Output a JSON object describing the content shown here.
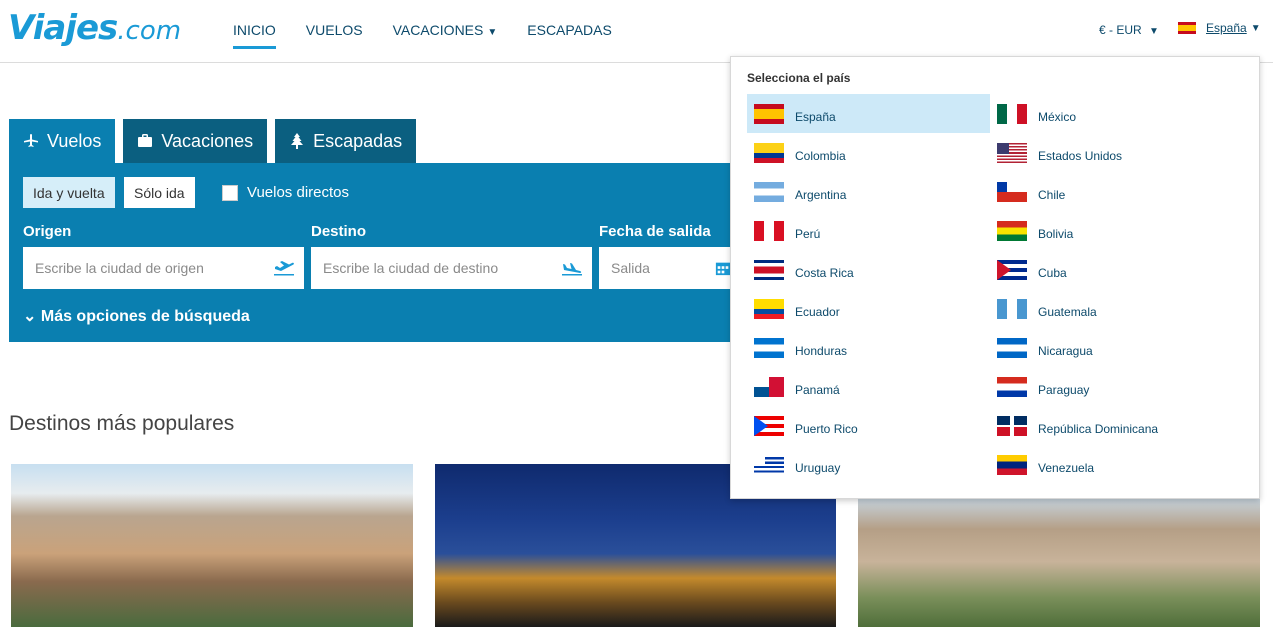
{
  "logo": {
    "text": "Viajes",
    "domain": ".com",
    "color": "#1a9ad6"
  },
  "nav": [
    {
      "label": "INICIO",
      "active": true
    },
    {
      "label": "VUELOS"
    },
    {
      "label": "VACACIONES",
      "caret": "▼"
    },
    {
      "label": "ESCAPADAS"
    }
  ],
  "header": {
    "currency": "€ - EUR",
    "caret": "▼",
    "country": "España",
    "country_flag": "es"
  },
  "search": {
    "tabs": [
      {
        "label": "Vuelos",
        "icon": "plane-icon",
        "active": true
      },
      {
        "label": "Vacaciones",
        "icon": "suitcase-icon"
      },
      {
        "label": "Escapadas",
        "icon": "tree-icon"
      }
    ],
    "trip_types": [
      {
        "label": "Ida y vuelta",
        "selected": true
      },
      {
        "label": "Sólo ida"
      }
    ],
    "direct_label": "Vuelos directos",
    "origin": {
      "label": "Origen",
      "placeholder": "Escribe la ciudad de origen",
      "icon": "plane-takeoff-icon"
    },
    "destination": {
      "label": "Destino",
      "placeholder": "Escribe la ciudad de destino",
      "icon": "plane-landing-icon"
    },
    "departure": {
      "label": "Fecha de salida",
      "placeholder": "Salida",
      "icon": "calendar-icon"
    },
    "more_options": "Más opciones de búsqueda",
    "more_caret": "⌄"
  },
  "popular": {
    "title": "Destinos más populares"
  },
  "country_dropdown": {
    "title": "Selecciona el país",
    "countries": [
      {
        "name": "España",
        "flag": "es",
        "selected": true
      },
      {
        "name": "México",
        "flag": "mx"
      },
      {
        "name": "Colombia",
        "flag": "co"
      },
      {
        "name": "Estados Unidos",
        "flag": "us"
      },
      {
        "name": "Argentina",
        "flag": "ar"
      },
      {
        "name": "Chile",
        "flag": "cl"
      },
      {
        "name": "Perú",
        "flag": "pe"
      },
      {
        "name": "Bolivia",
        "flag": "bo"
      },
      {
        "name": "Costa Rica",
        "flag": "cr"
      },
      {
        "name": "Cuba",
        "flag": "cu"
      },
      {
        "name": "Ecuador",
        "flag": "ec"
      },
      {
        "name": "Guatemala",
        "flag": "gt"
      },
      {
        "name": "Honduras",
        "flag": "hn"
      },
      {
        "name": "Nicaragua",
        "flag": "ni"
      },
      {
        "name": "Panamá",
        "flag": "pa"
      },
      {
        "name": "Paraguay",
        "flag": "py"
      },
      {
        "name": "Puerto Rico",
        "flag": "pr"
      },
      {
        "name": "República Dominicana",
        "flag": "do"
      },
      {
        "name": "Uruguay",
        "flag": "uy"
      },
      {
        "name": "Venezuela",
        "flag": "ve"
      }
    ]
  }
}
